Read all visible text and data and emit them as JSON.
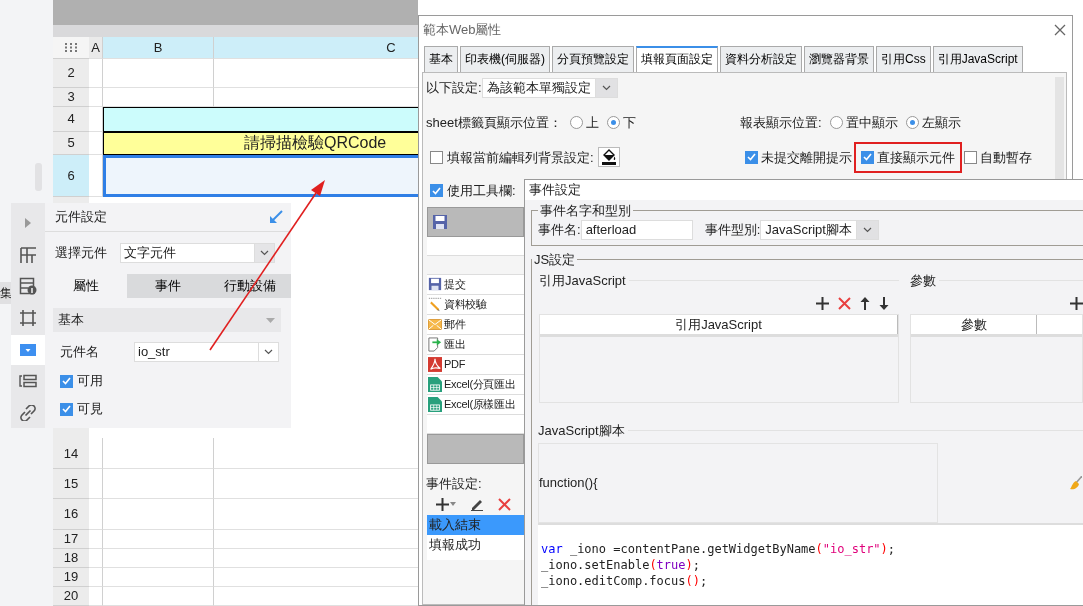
{
  "side_label": "集",
  "spreadsheet": {
    "columns": [
      {
        "label": "A",
        "selected": false
      },
      {
        "label": "B",
        "selected": true
      },
      {
        "label": "C",
        "selected": true
      }
    ],
    "rows_top": [
      {
        "number": "2",
        "kind": "plain",
        "selected": false
      },
      {
        "number": "3",
        "kind": "plain",
        "selected": false
      },
      {
        "number": "4",
        "kind": "band",
        "selected": false
      },
      {
        "number": "5",
        "kind": "title",
        "text": "請掃描檢驗QRCode",
        "selected": false
      },
      {
        "number": "6",
        "kind": "input",
        "selected": true
      }
    ],
    "rows_bottom": [
      {
        "number": "14"
      },
      {
        "number": "15"
      },
      {
        "number": "16"
      },
      {
        "number": "17"
      },
      {
        "number": "18"
      },
      {
        "number": "19"
      },
      {
        "number": "20"
      }
    ]
  },
  "widget_panel": {
    "title": "元件設定",
    "rail": [
      {
        "kind": "collapse",
        "selected": false
      },
      {
        "kind": "layout",
        "selected": false
      },
      {
        "kind": "info",
        "selected": false
      },
      {
        "kind": "frame",
        "selected": false
      },
      {
        "kind": "dropdown",
        "selected": true
      },
      {
        "kind": "form",
        "selected": false
      },
      {
        "kind": "link",
        "selected": false
      }
    ],
    "select_label": "選擇元件",
    "select_value": "文字元件",
    "tabs": [
      {
        "label": "屬性",
        "selected": true
      },
      {
        "label": "事件",
        "selected": false
      },
      {
        "label": "行動設備",
        "selected": false
      }
    ],
    "section": "基本",
    "name_label": "元件名",
    "name_value": "io_str",
    "options": [
      {
        "label": "可用",
        "checked": true
      },
      {
        "label": "可見",
        "checked": true
      }
    ]
  },
  "dialog": {
    "title": "範本Web屬性",
    "tabs": [
      {
        "label": "基本",
        "selected": false
      },
      {
        "label": "印表機(伺服器)",
        "selected": false
      },
      {
        "label": "分頁預覽設定",
        "selected": false
      },
      {
        "label": "填報頁面設定",
        "selected": true
      },
      {
        "label": "資料分析設定",
        "selected": false
      },
      {
        "label": "瀏覽器背景",
        "selected": false
      },
      {
        "label": "引用Css",
        "selected": false
      },
      {
        "label": "引用JavaScript",
        "selected": false
      }
    ],
    "scope_label": "以下設定:",
    "scope_value": "為該範本單獨設定",
    "sheet_tab_position": {
      "label": "sheet標籤頁顯示位置：",
      "options": [
        {
          "label": "上",
          "selected": false
        },
        {
          "label": "下",
          "selected": true
        }
      ]
    },
    "report_position": {
      "label": "報表顯示位置:",
      "options": [
        {
          "label": "置中顯示",
          "selected": false
        },
        {
          "label": "左顯示",
          "selected": true
        }
      ]
    },
    "row_background": {
      "label": "填報當前編輯列背景設定:",
      "checked": false
    },
    "options": [
      {
        "label": "未提交離開提示",
        "checked": true,
        "highlighted": false
      },
      {
        "label": "直接顯示元件",
        "checked": true,
        "highlighted": true
      },
      {
        "label": "自動暫存",
        "checked": false,
        "highlighted": false
      }
    ],
    "toolbar": {
      "label": "使用工具欄:",
      "checked": true,
      "items": [
        {
          "kind": "submit",
          "label": "提交"
        },
        {
          "kind": "validate",
          "label": "資料校驗"
        },
        {
          "kind": "mail",
          "label": "郵件"
        },
        {
          "kind": "export",
          "label": "匯出"
        },
        {
          "kind": "pdf",
          "label": "PDF"
        },
        {
          "kind": "excel",
          "label": "Excel(分頁匯出"
        },
        {
          "kind": "excel",
          "label": "Excel(原樣匯出"
        }
      ]
    },
    "events": {
      "label": "事件設定:",
      "items": [
        {
          "label": "載入結束",
          "selected": true
        },
        {
          "label": "填報成功",
          "selected": false
        }
      ]
    }
  },
  "event_dialog": {
    "title": "事件設定",
    "name_group": "事件名字和型別",
    "name_label": "事件名:",
    "name_value": "afterload",
    "type_label": "事件型別:",
    "type_value": "JavaScript腳本",
    "js_group": "JS設定",
    "reference": {
      "title": "引用JavaScript",
      "actions": [
        {
          "kind": "add"
        },
        {
          "kind": "delete"
        },
        {
          "kind": "up"
        },
        {
          "kind": "down"
        }
      ],
      "column": "引用JavaScript"
    },
    "parameters": {
      "title": "參數",
      "actions": [
        {
          "kind": "add"
        }
      ],
      "column": "參數"
    },
    "script": {
      "title": "JavaScript腳本",
      "header": "function(){",
      "lines": [
        [
          {
            "kind": "keyword",
            "text": "var"
          },
          {
            "kind": "plain",
            "text": " _iono =contentPane.getWidgetByName"
          },
          {
            "kind": "paren",
            "text": "("
          },
          {
            "kind": "string",
            "text": "\"io_str\""
          },
          {
            "kind": "paren",
            "text": ")"
          },
          {
            "kind": "plain",
            "text": ";"
          }
        ],
        [
          {
            "kind": "plain",
            "text": "_iono.setEnable"
          },
          {
            "kind": "paren",
            "text": "("
          },
          {
            "kind": "literal",
            "text": "true"
          },
          {
            "kind": "paren",
            "text": ")"
          },
          {
            "kind": "plain",
            "text": ";"
          }
        ],
        [
          {
            "kind": "plain",
            "text": "_iono.editComp.focus"
          },
          {
            "kind": "paren",
            "text": "()"
          },
          {
            "kind": "plain",
            "text": ";"
          }
        ]
      ]
    }
  }
}
